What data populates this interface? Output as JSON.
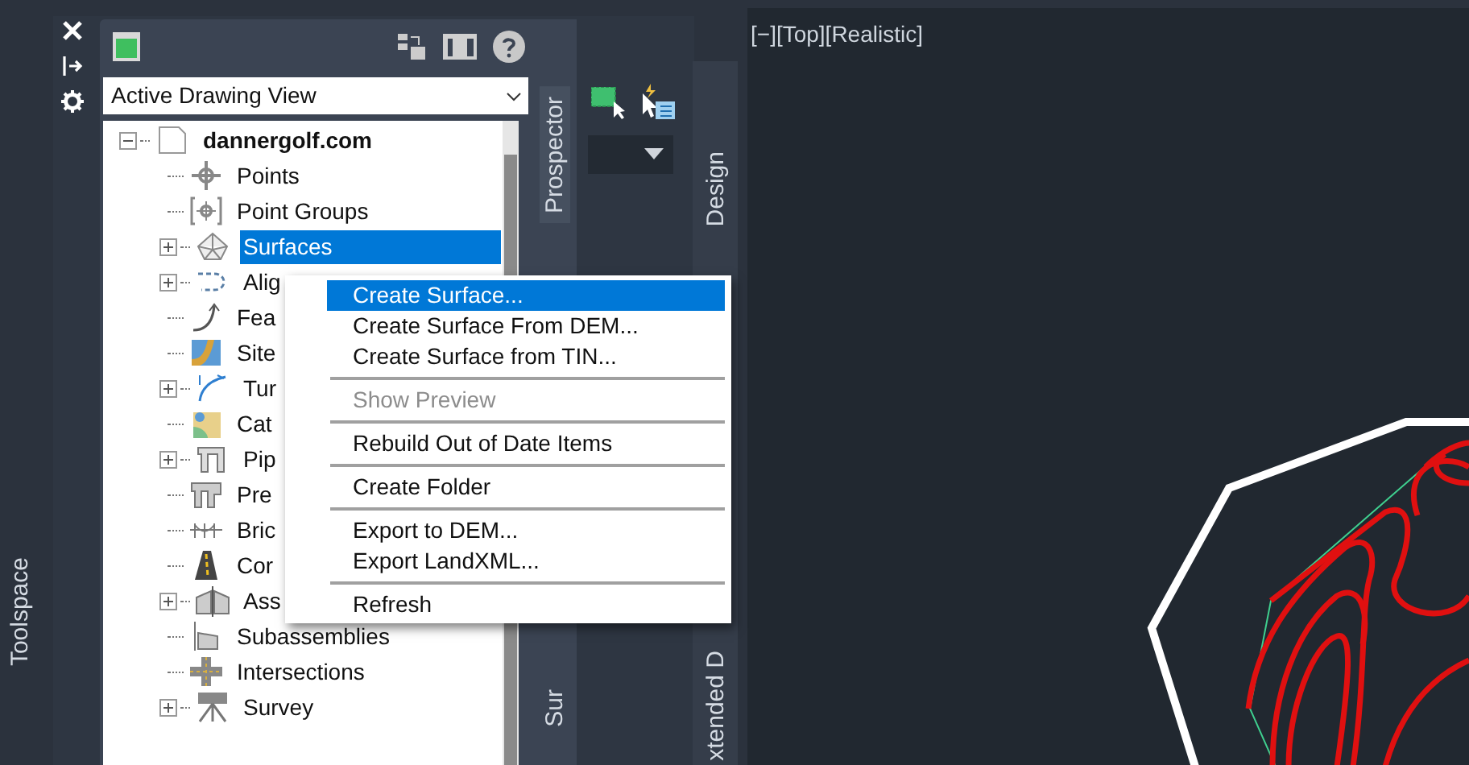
{
  "toolspace": {
    "title": "Toolspace"
  },
  "panel": {
    "view_selector": {
      "value": "Active Drawing View"
    },
    "tree": [
      {
        "label": "dannergolf.com",
        "expanded": true,
        "selected": false,
        "children": [
          {
            "label": "Points",
            "selected": false
          },
          {
            "label": "Point Groups",
            "selected": false
          },
          {
            "label": "Surfaces",
            "expanded": false,
            "selected": true
          },
          {
            "label": "Alig",
            "expanded": false,
            "selected": false
          },
          {
            "label": "Fea",
            "selected": false
          },
          {
            "label": "Site",
            "selected": false
          },
          {
            "label": "Tur",
            "expanded": false,
            "selected": false
          },
          {
            "label": "Cat",
            "selected": false
          },
          {
            "label": "Pip",
            "expanded": false,
            "selected": false
          },
          {
            "label": "Pre",
            "selected": false
          },
          {
            "label": "Bric",
            "selected": false
          },
          {
            "label": "Cor",
            "selected": false
          },
          {
            "label": "Ass",
            "expanded": false,
            "selected": false
          },
          {
            "label": "Subassemblies",
            "selected": false
          },
          {
            "label": "Intersections",
            "selected": false
          },
          {
            "label": "Survey",
            "expanded": false,
            "selected": false
          }
        ]
      }
    ]
  },
  "tabs": [
    {
      "label": "Prospector",
      "selected": true
    },
    {
      "label": "Sur",
      "selected": false
    }
  ],
  "side_tabs": [
    {
      "label": "Design",
      "selected": false
    },
    {
      "label": "xtended D",
      "selected": false
    }
  ],
  "viewport": {
    "label": "[−][Top][Realistic]"
  },
  "context_menu": {
    "items": [
      {
        "kind": "item",
        "label": "Create Surface...",
        "selected": true,
        "disabled": false
      },
      {
        "kind": "item",
        "label": "Create Surface From DEM...",
        "selected": false,
        "disabled": false
      },
      {
        "kind": "item",
        "label": "Create Surface from TIN...",
        "selected": false,
        "disabled": false
      },
      {
        "kind": "separator"
      },
      {
        "kind": "item",
        "label": "Show Preview",
        "selected": false,
        "disabled": true
      },
      {
        "kind": "separator"
      },
      {
        "kind": "item",
        "label": "Rebuild Out of Date Items",
        "selected": false,
        "disabled": false
      },
      {
        "kind": "separator"
      },
      {
        "kind": "item",
        "label": "Create Folder",
        "selected": false,
        "disabled": false
      },
      {
        "kind": "separator"
      },
      {
        "kind": "item",
        "label": "Export to DEM...",
        "selected": false,
        "disabled": false
      },
      {
        "kind": "item",
        "label": "Export LandXML...",
        "selected": false,
        "disabled": false
      },
      {
        "kind": "separator"
      },
      {
        "kind": "item",
        "label": "Refresh",
        "selected": false,
        "disabled": false
      }
    ]
  }
}
